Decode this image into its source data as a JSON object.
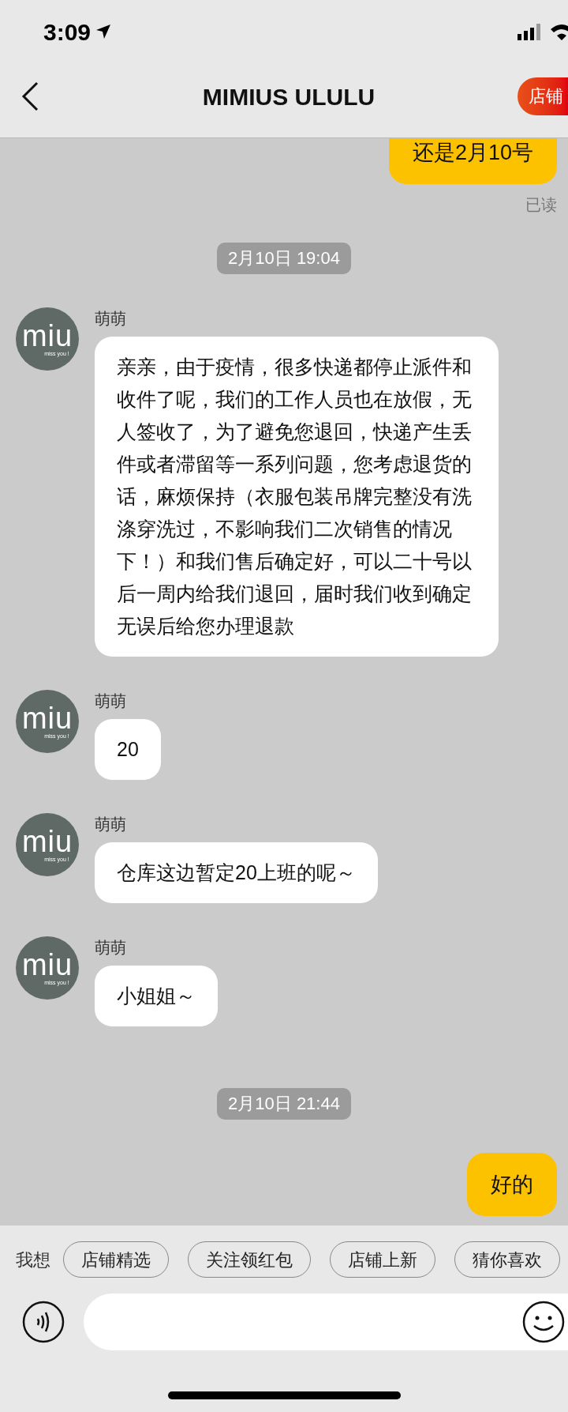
{
  "status_bar": {
    "time": "3:09"
  },
  "header": {
    "title": "MIMIUS ULULU",
    "shop_button": "店铺"
  },
  "messages": [
    {
      "kind": "sent",
      "text": "还是2月10号",
      "status": "已读"
    },
    {
      "kind": "time",
      "text": "2月10日 19:04"
    },
    {
      "kind": "received",
      "sender": "萌萌",
      "avatar_logo": "miu",
      "avatar_tagline": "miss you !",
      "text": "亲亲，由于疫情，很多快递都停止派件和收件了呢，我们的工作人员也在放假，无人签收了，为了避免您退回，快递产生丢件或者滞留等一系列问题，您考虑退货的话，麻烦保持（衣服包装吊牌完整没有洗涤穿洗过，不影响我们二次销售的情况下！）和我们售后确定好，可以二十号以后一周内给我们退回，届时我们收到确定无误后给您办理退款"
    },
    {
      "kind": "received",
      "sender": "萌萌",
      "avatar_logo": "miu",
      "avatar_tagline": "miss you !",
      "text": "20"
    },
    {
      "kind": "received",
      "sender": "萌萌",
      "avatar_logo": "miu",
      "avatar_tagline": "miss you !",
      "text": "仓库这边暂定20上班的呢～"
    },
    {
      "kind": "received",
      "sender": "萌萌",
      "avatar_logo": "miu",
      "avatar_tagline": "miss you !",
      "text": "小姐姐～"
    },
    {
      "kind": "time",
      "text": "2月10日 21:44"
    },
    {
      "kind": "sent",
      "text": "好的"
    }
  ],
  "quick_replies": {
    "label": "我想",
    "chips": [
      "店铺精选",
      "关注领红包",
      "店铺上新",
      "猜你喜欢"
    ]
  }
}
